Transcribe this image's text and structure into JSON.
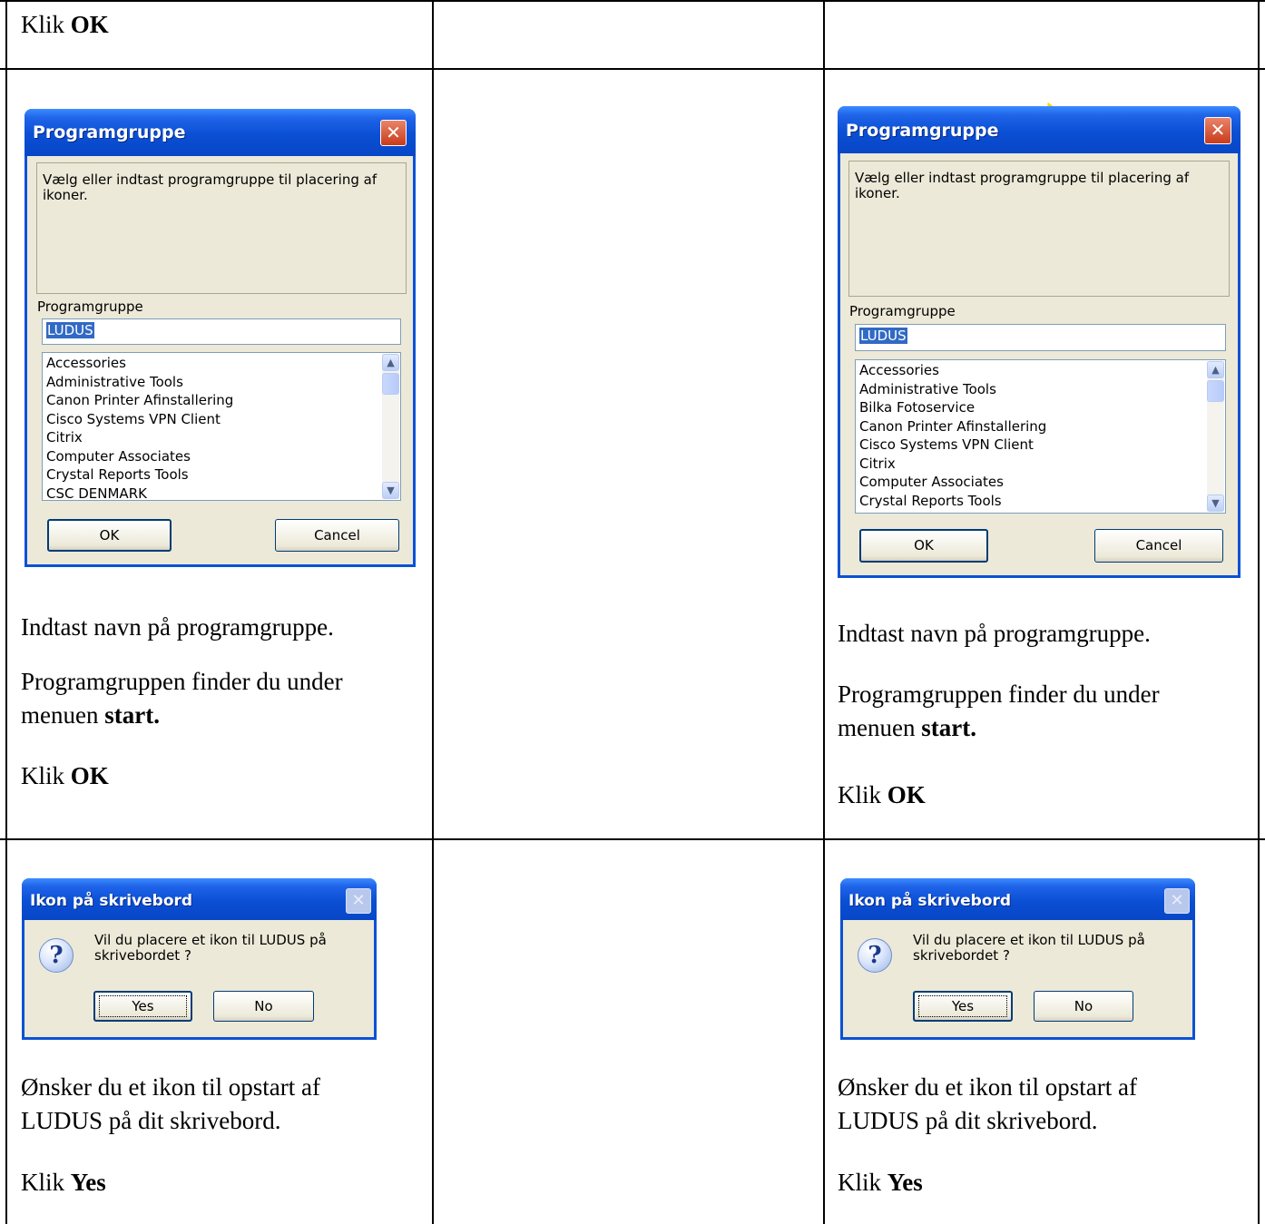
{
  "rows": [
    {
      "left_text": [
        {
          "prefix": "Klik ",
          "bold": "OK"
        }
      ]
    },
    {
      "dialog_title": "Programgruppe",
      "message": "Vælg eller indtast programgruppe til placering af ikoner.",
      "group_label": "Programgruppe",
      "group_value": "LUDUS",
      "list_left": [
        "Accessories",
        "Administrative Tools",
        "Canon Printer Afinstallering",
        "Cisco Systems VPN Client",
        "Citrix",
        "Computer Associates",
        "Crystal Reports Tools",
        "CSC DENMARK"
      ],
      "list_right": [
        "Accessories",
        "Administrative Tools",
        "Bilka Fotoservice",
        "Canon Printer Afinstallering",
        "Cisco Systems VPN Client",
        "Citrix",
        "Computer Associates",
        "Crystal Reports Tools"
      ],
      "ok_label": "OK",
      "cancel_label": "Cancel",
      "text": {
        "line1": "Indtast navn på programgruppe.",
        "line2": "Programgruppen finder du under",
        "line3_prefix": "menuen ",
        "line3_bold": "start.",
        "line4_prefix": "Klik ",
        "line4_bold": "OK"
      }
    },
    {
      "dialog_title": "Ikon på skrivebord",
      "message_line1": "Vil du placere et ikon til LUDUS på",
      "message_line2": "skrivebordet ?",
      "yes_label": "Yes",
      "no_label": "No",
      "text": {
        "line1": "Ønsker du et ikon til opstart af",
        "line2": "LUDUS på dit skrivebord.",
        "line3_prefix": "Klik ",
        "line3_bold": "Yes"
      }
    }
  ],
  "icons": {
    "dialog_close": "close-icon",
    "scroll_up": "chevron-up-icon",
    "scroll_down": "chevron-down-icon",
    "question": "question-icon",
    "cursor": "cursor-icon"
  }
}
